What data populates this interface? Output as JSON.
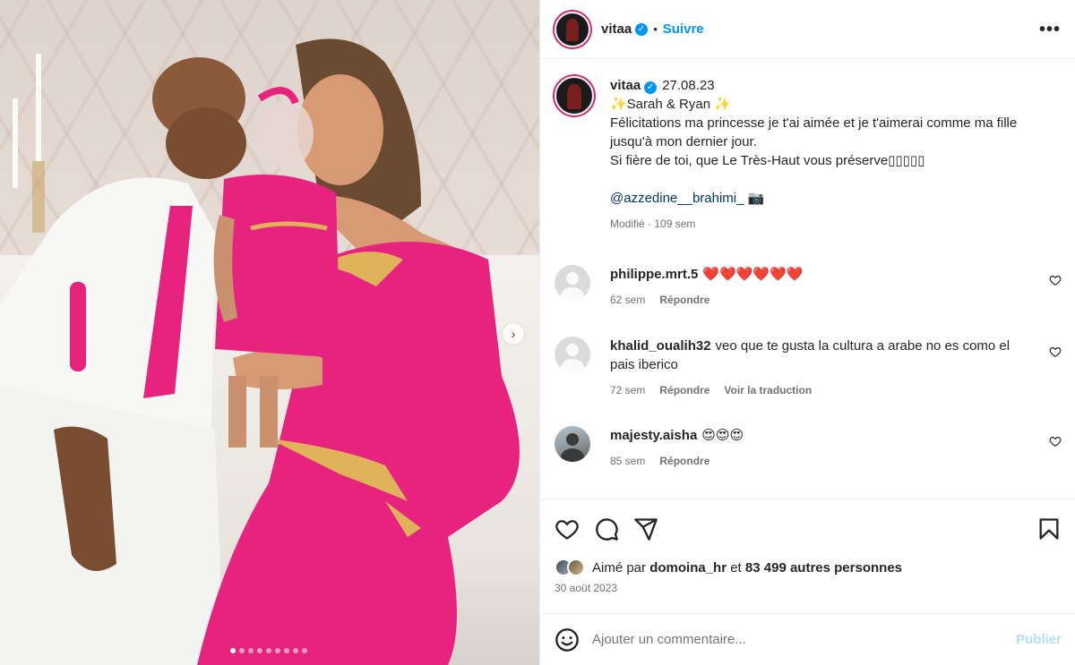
{
  "post": {
    "username": "vitaa",
    "follow_label": "Suivre",
    "separator": "•",
    "more_label": "•••",
    "verified_mark": "✓",
    "photo_dots": 9,
    "active_dot": 0,
    "next_arrow": "›"
  },
  "caption": {
    "username": "vitaa",
    "date": "27.08.23",
    "lines": [
      "✨Sarah & Ryan ✨",
      "Félicitations ma princesse je t'ai aimée et je t'aimerai comme ma fille jusqu'à mon dernier jour.",
      "Si fière de toi, que Le Très-Haut vous préserve▯▯▯▯▯"
    ],
    "mention": "@azzedine__brahimi_ 📷",
    "meta": "Modifié · 109 sem"
  },
  "comments": [
    {
      "user": "philippe.mrt.5",
      "text": "❤️❤️❤️❤️❤️❤️",
      "age": "62 sem",
      "reply": "Répondre",
      "translate": ""
    },
    {
      "user": "khalid_oualih32",
      "text": "veo que te gusta la cultura a arabe no es como el pais iberico",
      "age": "72 sem",
      "reply": "Répondre",
      "translate": "Voir la traduction"
    },
    {
      "user": "majesty.aisha",
      "text": "😍😍😍",
      "age": "85 sem",
      "reply": "Répondre",
      "translate": ""
    }
  ],
  "likes": {
    "prefix": "Aimé par",
    "user": "domoina_hr",
    "middle": "et",
    "count": "83 499 autres personnes"
  },
  "post_date": "30 août 2023",
  "add_comment": {
    "placeholder": "Ajouter un commentaire...",
    "publish": "Publier"
  },
  "icons": [
    "heart-icon",
    "comment-icon",
    "share-icon",
    "bookmark-icon",
    "emoji-icon"
  ],
  "colors": {
    "accent": "#0095f6",
    "link": "#00376b",
    "muted": "#737373",
    "publish_disabled": "#b2dffc",
    "dress_pink": "#e8237f"
  }
}
